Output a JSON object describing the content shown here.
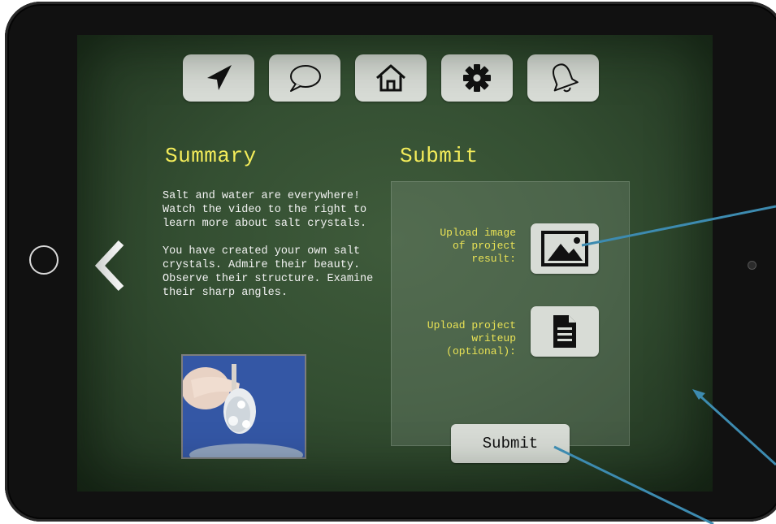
{
  "nav": {
    "items": [
      {
        "icon": "navigate-arrow-icon"
      },
      {
        "icon": "chat-bubble-icon"
      },
      {
        "icon": "home-icon"
      },
      {
        "icon": "gear-icon"
      },
      {
        "icon": "bell-icon"
      }
    ]
  },
  "summary": {
    "title": "Summary",
    "text": "Salt and water are everywhere! Watch the video to the right to learn more about salt crystals.\n\nYou have created your own salt crystals. Admire their beauty. Observe their structure. Examine their sharp angles."
  },
  "submit": {
    "title": "Submit",
    "upload_image_label": "Upload image\nof project\nresult:",
    "upload_writeup_label": "Upload project\nwriteup\n(optional):",
    "submit_label": "Submit"
  },
  "colors": {
    "chalkboard": "#344f32",
    "heading": "#f3ec5a",
    "button_bg": "#d8dcd6",
    "callout_line": "#3d8bb0"
  }
}
